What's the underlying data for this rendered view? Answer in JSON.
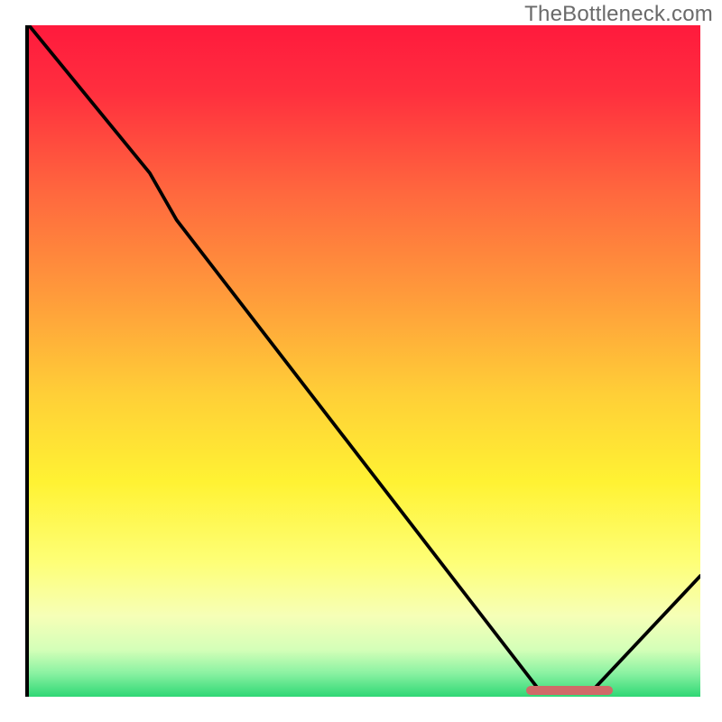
{
  "watermark": "TheBottleneck.com",
  "colors": {
    "gradient_stops": [
      {
        "offset": 0.0,
        "color": "#ff1a3d"
      },
      {
        "offset": 0.1,
        "color": "#ff2f3e"
      },
      {
        "offset": 0.25,
        "color": "#ff683e"
      },
      {
        "offset": 0.4,
        "color": "#ff9a3b"
      },
      {
        "offset": 0.55,
        "color": "#ffcf37"
      },
      {
        "offset": 0.68,
        "color": "#fff233"
      },
      {
        "offset": 0.8,
        "color": "#feff77"
      },
      {
        "offset": 0.88,
        "color": "#f6ffb7"
      },
      {
        "offset": 0.93,
        "color": "#d4ffb8"
      },
      {
        "offset": 0.965,
        "color": "#8af2a2"
      },
      {
        "offset": 1.0,
        "color": "#2fd775"
      }
    ],
    "curve": "#000000",
    "marker": "#cf6a68",
    "axis": "#000000"
  },
  "chart_data": {
    "type": "line",
    "title": "",
    "xlabel": "",
    "ylabel": "",
    "xlim": [
      0,
      100
    ],
    "ylim": [
      0,
      100
    ],
    "x": [
      0,
      18,
      22,
      76,
      84,
      100
    ],
    "values": [
      100,
      78,
      71,
      1,
      1,
      18
    ],
    "marker_x_range": [
      74,
      87
    ],
    "marker_y": 1
  }
}
